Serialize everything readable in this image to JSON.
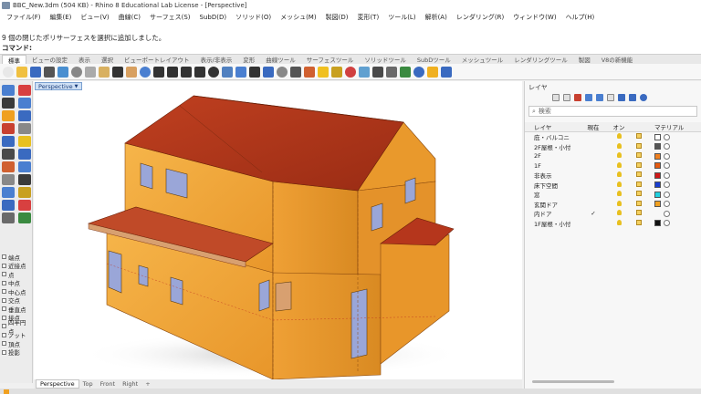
{
  "window": {
    "title": "BBC_New.3dm (504 KB) - Rhino 8 Educational Lab License - [Perspective]"
  },
  "menu": [
    "ファイル(F)",
    "編集(E)",
    "ビュー(V)",
    "曲線(C)",
    "サーフェス(S)",
    "SubD(D)",
    "ソリッド(O)",
    "メッシュ(M)",
    "製図(D)",
    "変形(T)",
    "ツール(L)",
    "解析(A)",
    "レンダリング(R)",
    "ウィンドウ(W)",
    "ヘルプ(H)"
  ],
  "command": {
    "history": "9 個の閉じたポリサーフェスを選択に追加しました。",
    "prompt": "コマンド:"
  },
  "toolbar_tabs": [
    "標準",
    "ビューの設定",
    "表示",
    "選択",
    "ビューポートレイアウト",
    "表示/非表示",
    "変形",
    "曲線ツール",
    "サーフェスツール",
    "ソリッドツール",
    "SubDツール",
    "メッシュツール",
    "レンダリングツール",
    "製図",
    "V8の新機能"
  ],
  "toolbar_icons": [
    "new-icon",
    "open-icon",
    "save-icon",
    "print-icon",
    "import-icon",
    "cut-icon",
    "copy-icon",
    "paste-icon",
    "undo-icon",
    "hand-icon",
    "rotate-icon",
    "zoom-icon",
    "zoom-window-icon",
    "zoom-extents-icon",
    "zoom-selected-icon",
    "light-icon",
    "grid-icon",
    "layer-icon",
    "properties-icon",
    "cplane-icon",
    "snap-icon",
    "render-icon",
    "material-icon",
    "bulb-icon",
    "lock-icon",
    "tag-icon",
    "ray-icon",
    "display-icon",
    "sphere-icon",
    "environment-icon",
    "arrow-icon",
    "sun-icon",
    "help-icon"
  ],
  "osnap": [
    "端点",
    "近接点",
    "点",
    "中点",
    "中心点",
    "交点",
    "垂直点",
    "接点",
    "四半円点",
    "ノット",
    "頂点",
    "投影"
  ],
  "viewport": {
    "label": "Perspective",
    "tabs": [
      "Perspective",
      "Top",
      "Front",
      "Right"
    ]
  },
  "layers": {
    "title": "レイヤ",
    "search_placeholder": "検索",
    "columns": [
      "レイヤ",
      "現在",
      "オン",
      "",
      "マテリアル"
    ],
    "rows": [
      {
        "name": "庇・バルコニ",
        "color": "#ffffff",
        "current": ""
      },
      {
        "name": "2F屋根・小付",
        "color": "#555555",
        "current": ""
      },
      {
        "name": "2F",
        "color": "#f08020",
        "current": ""
      },
      {
        "name": "1F",
        "color": "#e65a10",
        "current": ""
      },
      {
        "name": "非表示",
        "color": "#d01818",
        "current": ""
      },
      {
        "name": "床下空間",
        "color": "#1a3fd0",
        "current": ""
      },
      {
        "name": "窓",
        "color": "#20d0e0",
        "current": ""
      },
      {
        "name": "玄関ドア",
        "color": "#f0a020",
        "current": ""
      },
      {
        "name": "内ドア",
        "color": "",
        "current": "✓"
      },
      {
        "name": "1F屋根・小付",
        "color": "#111111",
        "current": ""
      }
    ]
  },
  "colors": {
    "wall": "#f2a83a",
    "roof": "#b5361c",
    "selection": "#cfe0f5"
  }
}
